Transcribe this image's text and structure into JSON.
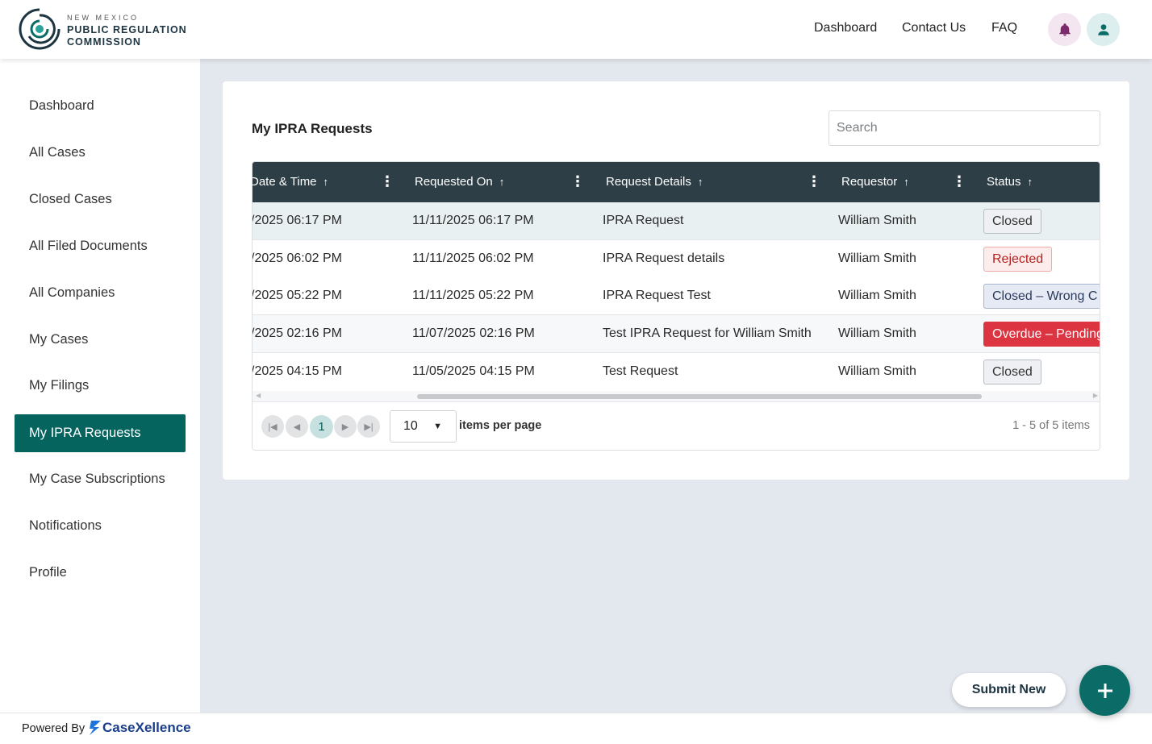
{
  "brand": {
    "line1": "NEW MEXICO",
    "line2": "PUBLIC REGULATION",
    "line3": "COMMISSION",
    "accent": "#0b6b66"
  },
  "top_nav": [
    {
      "label": "Dashboard"
    },
    {
      "label": "Contact Us"
    },
    {
      "label": "FAQ"
    }
  ],
  "header_icons": {
    "bell": "bell-icon",
    "user": "user-icon",
    "bell_color": "#7b2a6b",
    "user_color": "#0b6b66"
  },
  "sidebar": {
    "items": [
      {
        "label": "Dashboard"
      },
      {
        "label": "All Cases"
      },
      {
        "label": "Closed Cases"
      },
      {
        "label": "All Filed Documents"
      },
      {
        "label": "All Companies"
      },
      {
        "label": "My Cases"
      },
      {
        "label": "My Filings"
      },
      {
        "label": "My IPRA Requests",
        "active": true
      },
      {
        "label": "My Case Subscriptions"
      },
      {
        "label": "Notifications"
      },
      {
        "label": "Profile"
      }
    ]
  },
  "main": {
    "title": "My IPRA Requests",
    "search_placeholder": "Search",
    "columns": [
      "Date & Time",
      "Requested On",
      "Request Details",
      "Requestor",
      "Status"
    ],
    "rows": [
      {
        "datetime": "/2025 06:17 PM",
        "requested_on": "11/11/2025 06:17 PM",
        "details": "IPRA Request",
        "requestor": "William Smith",
        "status": "Closed",
        "status_kind": "closed"
      },
      {
        "datetime": "/2025 06:02 PM",
        "requested_on": "11/11/2025 06:02 PM",
        "details": "IPRA Request details",
        "requestor": "William Smith",
        "status": "Rejected",
        "status_kind": "rejected"
      },
      {
        "datetime": "/2025 05:22 PM",
        "requested_on": "11/11/2025 05:22 PM",
        "details": "IPRA Request Test",
        "requestor": "William Smith",
        "status": "Closed – Wrong C",
        "status_kind": "wrong"
      },
      {
        "datetime": "/2025 02:16 PM",
        "requested_on": "11/07/2025 02:16 PM",
        "details": "Test IPRA Request for William Smith",
        "requestor": "William Smith",
        "status": "Overdue – Pending",
        "status_kind": "overdue"
      },
      {
        "datetime": "/2025 04:15 PM",
        "requested_on": "11/05/2025 04:15 PM",
        "details": "Test Request",
        "requestor": "William Smith",
        "status": "Closed",
        "status_kind": "closed"
      }
    ],
    "pager": {
      "current_page": "1",
      "page_size": "10",
      "items_per_page_label": "items per page",
      "range": "1 - 5 of 5 items"
    }
  },
  "footer": {
    "powered_by": "Powered By",
    "brand": "CaseXellence"
  },
  "fab": {
    "submit_label": "Submit New"
  }
}
